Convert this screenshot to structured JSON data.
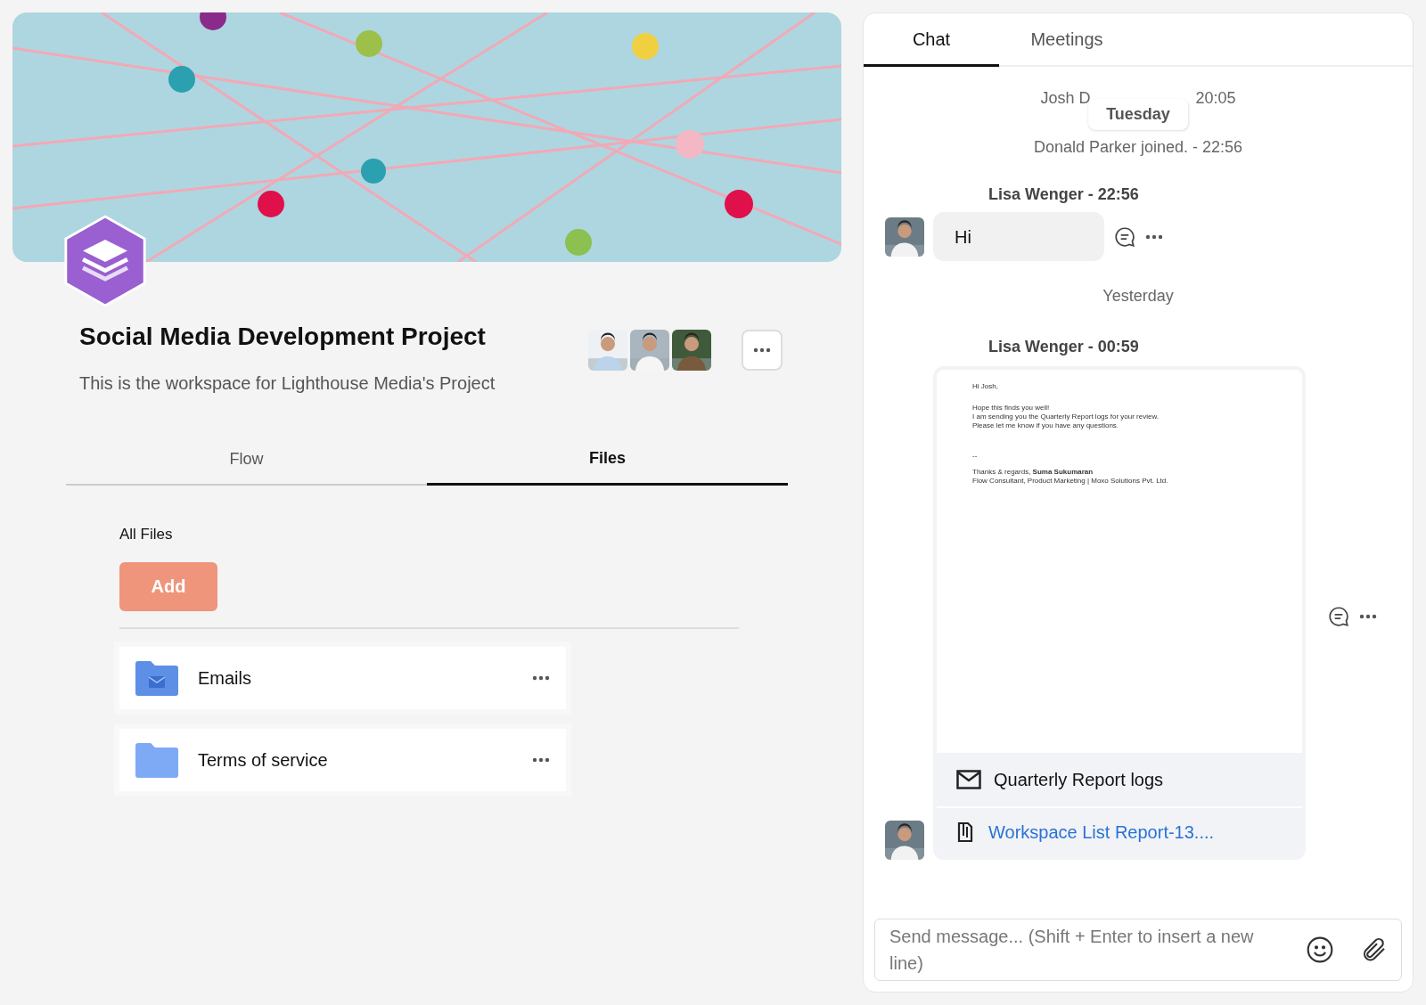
{
  "project": {
    "title": "Social Media Development Project",
    "description": "This is the workspace for Lighthouse Media's Project"
  },
  "tabs": [
    {
      "label": "Flow",
      "selected": false
    },
    {
      "label": "Files",
      "selected": true
    }
  ],
  "files": {
    "heading": "All Files",
    "add_button": "Add",
    "items": [
      {
        "name": "Emails",
        "kind": "email-folder"
      },
      {
        "name": "Terms of service",
        "kind": "folder"
      }
    ]
  },
  "chat": {
    "tabs": [
      {
        "label": "Chat",
        "selected": true
      },
      {
        "label": "Meetings",
        "selected": false
      }
    ],
    "date_badge": "Tuesday",
    "events": [
      {
        "parts": [
          "Josh D",
          "20:05"
        ]
      },
      {
        "parts": [
          "Donald Parker joined. - 22:56"
        ]
      }
    ],
    "messages": [
      {
        "kind": "text",
        "sender": "Lisa Wenger - 22:56",
        "text": "Hi"
      },
      {
        "kind": "divider",
        "text": "Yesterday"
      },
      {
        "kind": "document",
        "sender": "Lisa Wenger - 00:59",
        "preview": [
          "Hi Josh,",
          "Hope this finds you well!",
          "I am sending you the Quarterly Report logs for your review.",
          "Please let me know if you have any questions.",
          "--",
          "Thanks & regards, **Suma Sukumaran**",
          "Flow Consultant, Product Marketing | Moxo Solutions Pvt. Ltd."
        ],
        "subject": "Quarterly Report logs",
        "attachment": "Workspace List Report-13...."
      }
    ],
    "input": {
      "placeholder": "Send message... (Shift + Enter to insert a new line)"
    }
  }
}
